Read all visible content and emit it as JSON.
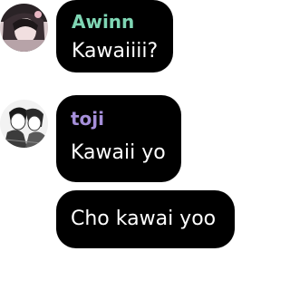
{
  "messages": [
    {
      "sender": "Awinn",
      "name_color": "#7fd6b4",
      "text": "Kawaiiii?",
      "avatar_icon": "user-avatar-awinn"
    },
    {
      "sender": "toji",
      "name_color": "#a58fd9",
      "text": "Kawaii yo",
      "avatar_icon": "user-avatar-toji"
    },
    {
      "sender": "",
      "text": "Cho kawai yoo"
    }
  ],
  "colors": {
    "bubble": "#000000",
    "text": "#ffffff",
    "background": "#ffffff"
  }
}
